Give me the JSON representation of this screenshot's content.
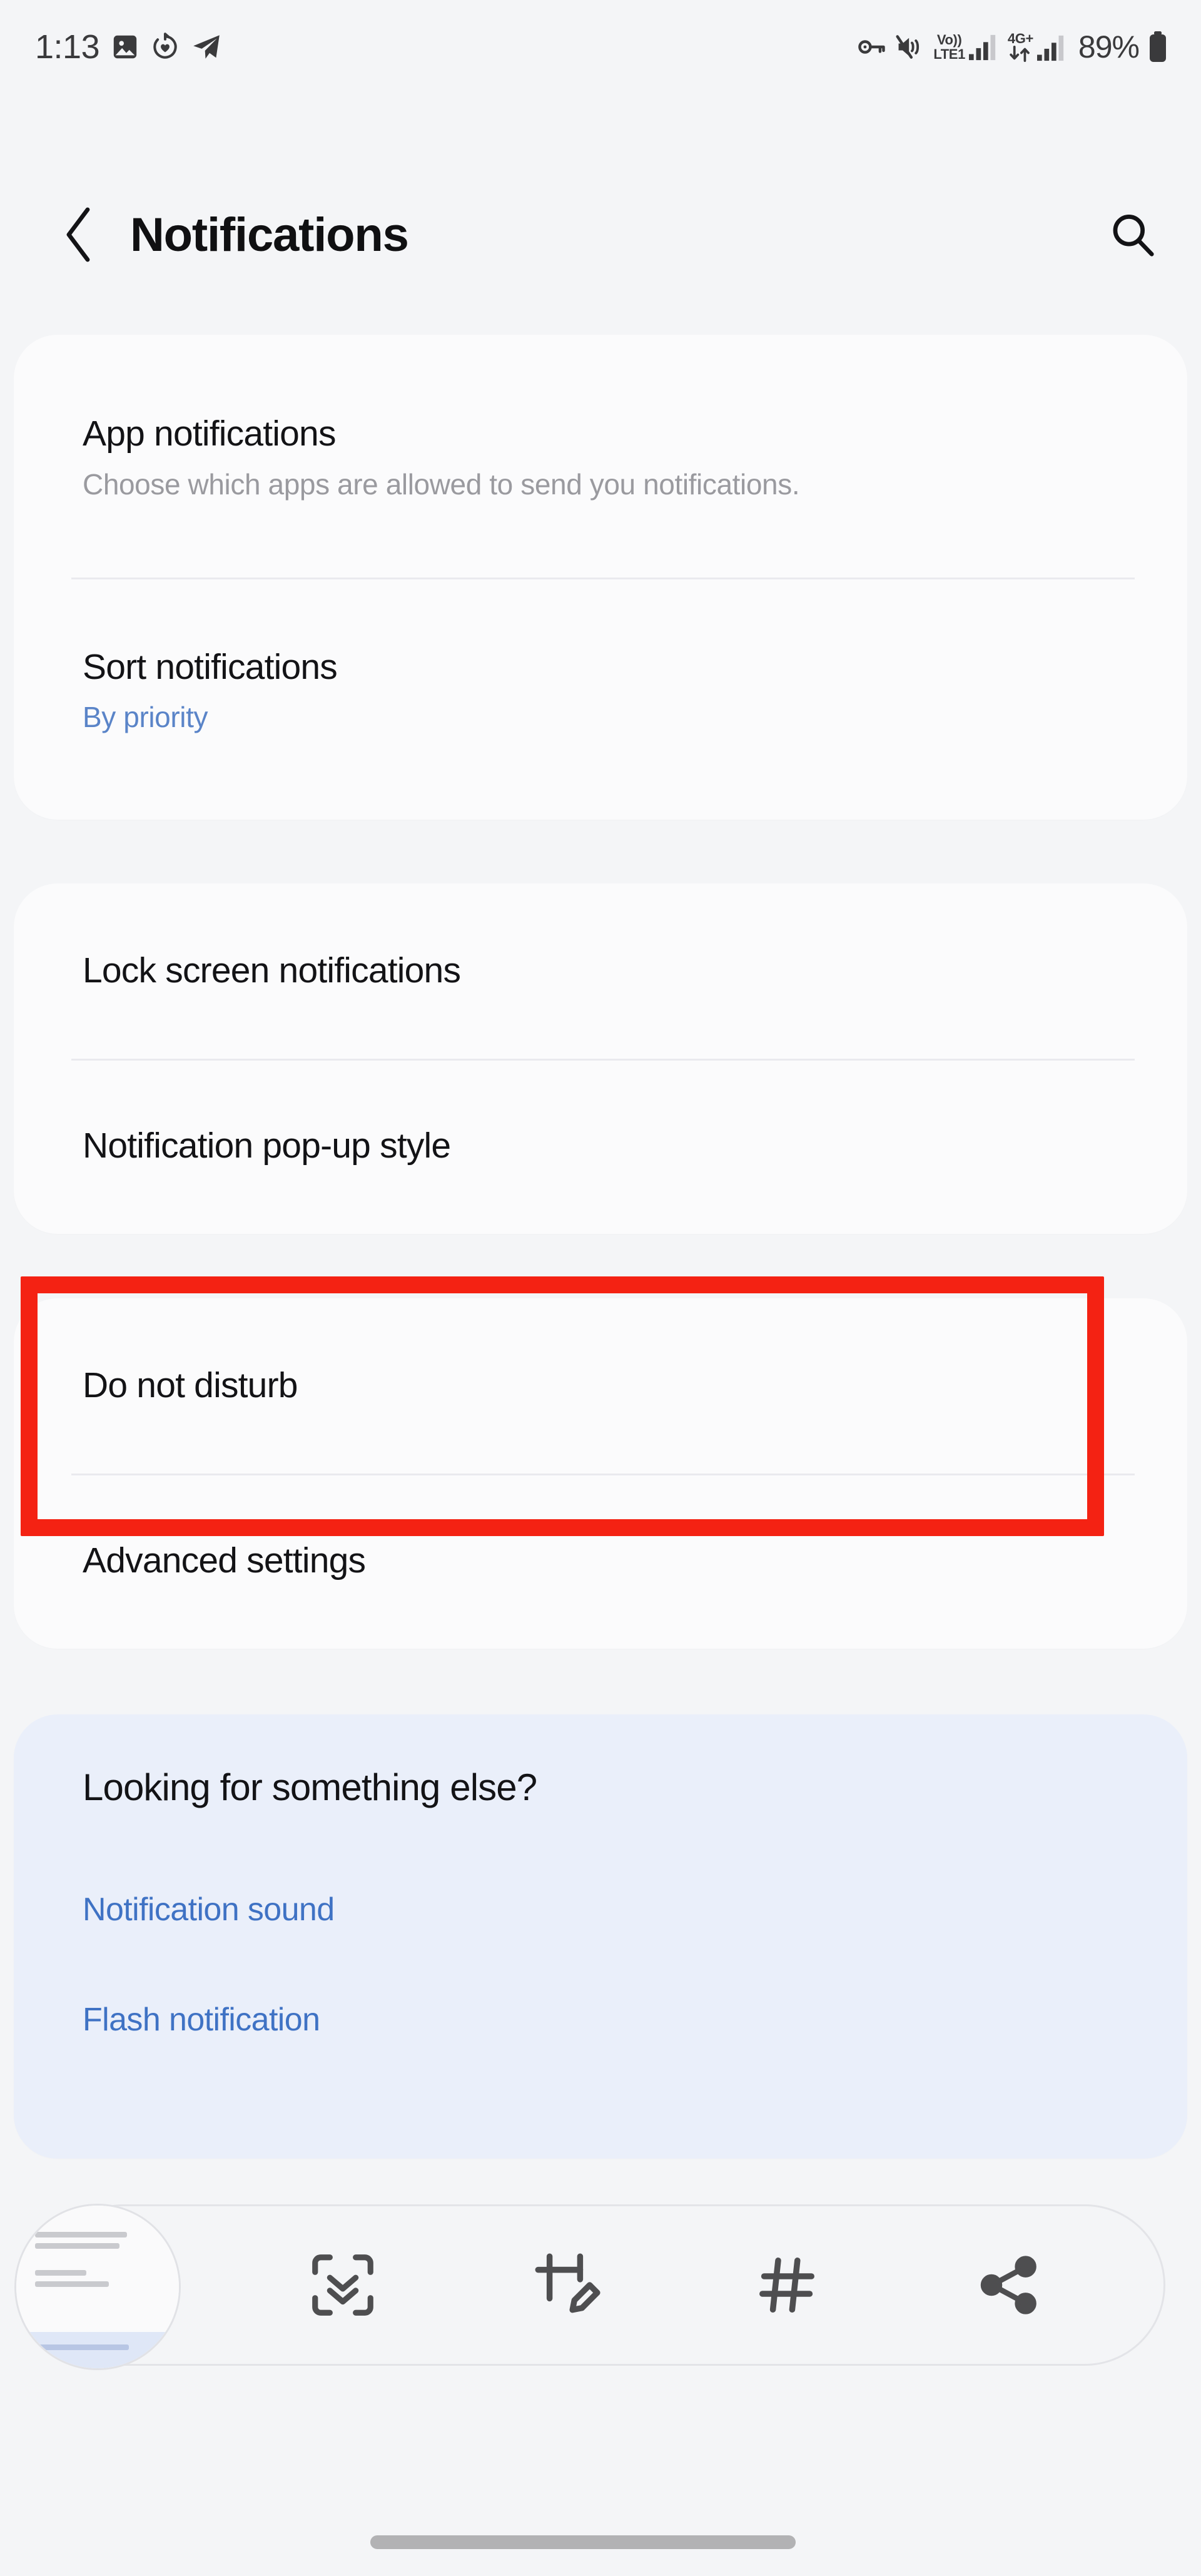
{
  "status_bar": {
    "clock": "1:13",
    "left_icons": [
      "image-icon",
      "heart-refresh-icon",
      "telegram-icon"
    ],
    "right_icons": [
      "key-icon",
      "mute-vibrate-icon"
    ],
    "volte_top": "Vo))",
    "volte_bottom": "LTE1",
    "network_type": "4G+",
    "battery_percent": "89%"
  },
  "header": {
    "back_label": "back-chevron",
    "title": "Notifications",
    "search_label": "search"
  },
  "cards": [
    {
      "rows": [
        {
          "title": "App notifications",
          "sub": "Choose which apps are allowed to send you notifications."
        },
        {
          "title": "Sort notifications",
          "value": "By priority"
        }
      ]
    },
    {
      "rows": [
        {
          "title": "Lock screen notifications"
        },
        {
          "title": "Notification pop-up style"
        }
      ]
    },
    {
      "rows": [
        {
          "title": "Do not disturb"
        },
        {
          "title": "Advanced settings"
        }
      ]
    }
  ],
  "looking_card": {
    "heading": "Looking for something else?",
    "links": [
      "Notification sound",
      "Flash notification"
    ]
  },
  "annotation": {
    "color": "#f42213",
    "target": "Do not disturb"
  },
  "toolbar": {
    "icons": [
      "screenshot-thumbnail",
      "scroll-capture-icon",
      "crop-edit-icon",
      "tags-icon",
      "share-icon"
    ]
  },
  "colors": {
    "background": "#f4f5f7",
    "card": "#fbfbfc",
    "card_highlight": "#eaeffa",
    "link": "#3f72c4",
    "value": "#5a84c8",
    "subtext": "#9a9a9f",
    "title": "#131316",
    "annotation": "#f42213"
  }
}
